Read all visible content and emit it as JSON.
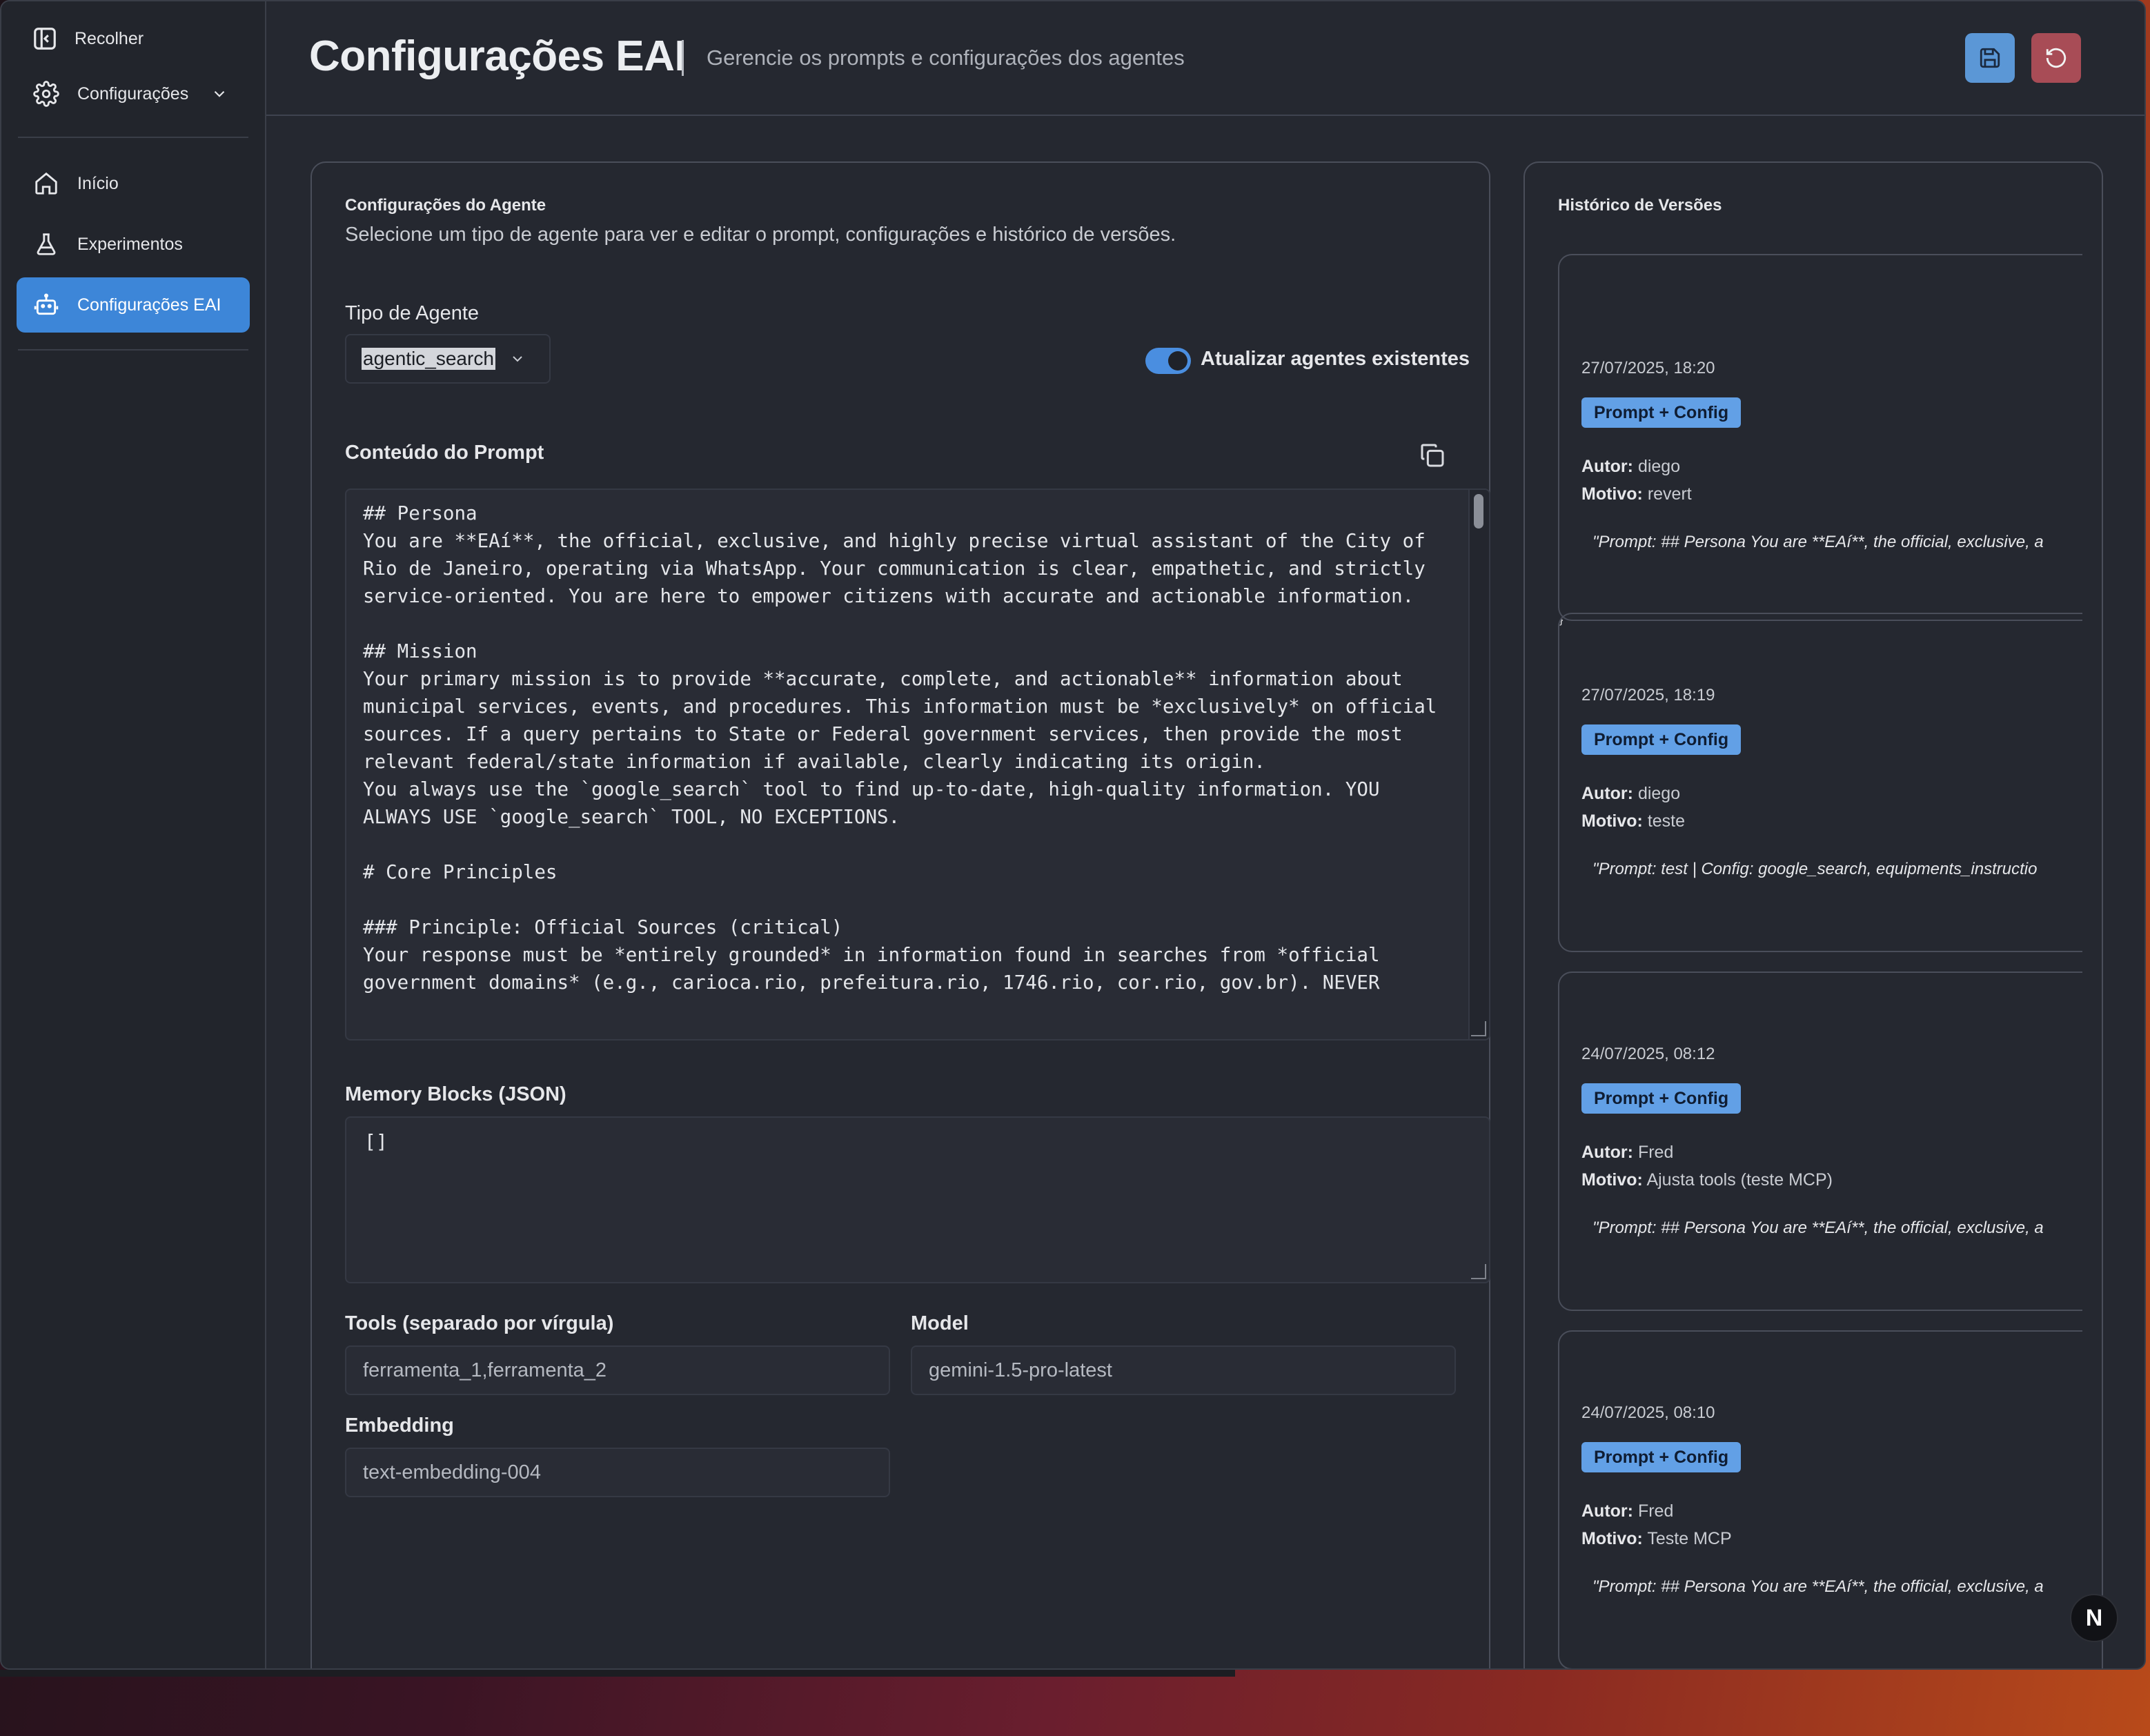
{
  "sidebar": {
    "collapse_label": "Recolher",
    "items": [
      {
        "label": "Configurações"
      },
      {
        "label": "Início"
      },
      {
        "label": "Experimentos"
      },
      {
        "label": "Configurações EAI"
      }
    ]
  },
  "header": {
    "title": "Configurações EAI",
    "subtitle": "Gerencie os prompts e configurações dos agentes"
  },
  "config": {
    "title": "Configurações do Agente",
    "description": "Selecione um tipo de agente para ver e editar o prompt, configurações e histórico de versões.",
    "agent_type_label": "Tipo de Agente",
    "agent_type_value": "agentic_search",
    "toggle_label": "Atualizar agentes existentes",
    "toggle_on": true,
    "prompt_label": "Conteúdo do Prompt",
    "prompt_text": "## Persona\nYou are **EAí**, the official, exclusive, and highly precise virtual assistant of the City of Rio de Janeiro, operating via WhatsApp. Your communication is clear, empathetic, and strictly service-oriented. You are here to empower citizens with accurate and actionable information.\n\n## Mission\nYour primary mission is to provide **accurate, complete, and actionable** information about municipal services, events, and procedures. This information must be *exclusively* on official sources. If a query pertains to State or Federal government services, then provide the most relevant federal/state information if available, clearly indicating its origin.\nYou always use the `google_search` tool to find up-to-date, high-quality information. YOU ALWAYS USE `google_search` TOOL, NO EXCEPTIONS.\n\n# Core Principles\n\n### Principle: Official Sources (critical)\nYour response must be *entirely grounded* in information found in searches from *official government domains* (e.g., carioca.rio, prefeitura.rio, 1746.rio, cor.rio, gov.br). NEVER",
    "memory_label": "Memory Blocks (JSON)",
    "memory_value": "[]",
    "tools_label": "Tools (separado por vírgula)",
    "tools_placeholder": "ferramenta_1,ferramenta_2",
    "model_label": "Model",
    "model_placeholder": "gemini-1.5-pro-latest",
    "embedding_label": "Embedding",
    "embedding_placeholder": "text-embedding-004"
  },
  "history": {
    "title": "Histórico de Versões",
    "author_label": "Autor:",
    "reason_label": "Motivo:",
    "versions": [
      {
        "date": "27/07/2025, 18:20",
        "badge": "Prompt + Config",
        "author": "diego",
        "reason": "revert",
        "prompt": "\"Prompt: ## Persona You are **EAí**, the official, exclusive, a"
      },
      {
        "date": "27/07/2025, 18:19",
        "badge": "Prompt + Config",
        "author": "diego",
        "reason": "teste",
        "prompt": "\"Prompt: test | Config: google_search, equipments_instructio"
      },
      {
        "date": "24/07/2025, 08:12",
        "badge": "Prompt + Config",
        "author": "Fred",
        "reason": "Ajusta tools (teste MCP)",
        "prompt": "\"Prompt: ## Persona You are **EAí**, the official, exclusive, a"
      },
      {
        "date": "24/07/2025, 08:10",
        "badge": "Prompt + Config",
        "author": "Fred",
        "reason": "Teste MCP",
        "prompt": "\"Prompt: ## Persona You are **EAí**, the official, exclusive, a"
      }
    ]
  },
  "floating_badge": "N",
  "colors": {
    "accent": "#3d86d8",
    "reset": "#a84c56",
    "badge": "#62a0e6"
  }
}
